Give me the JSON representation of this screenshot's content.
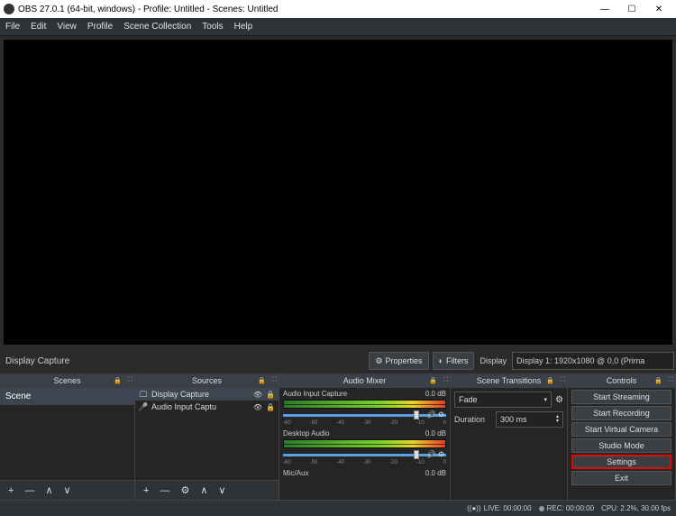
{
  "window": {
    "title": "OBS 27.0.1 (64-bit, windows) - Profile: Untitled - Scenes: Untitled",
    "minimize": "—",
    "maximize": "☐",
    "close": "✕"
  },
  "menubar": {
    "file": "File",
    "edit": "Edit",
    "view": "View",
    "profile": "Profile",
    "scene": "Scene Collection",
    "tools": "Tools",
    "help": "Help"
  },
  "context": {
    "source_name": "Display Capture",
    "properties": "Properties",
    "filters": "Filters",
    "display_label": "Display",
    "display_select": "Display 1: 1920x1080 @ 0,0 (Prima"
  },
  "scenes": {
    "header": "Scenes",
    "items": [
      "Scene"
    ]
  },
  "sources": {
    "header": "Sources",
    "items": [
      {
        "type": "display",
        "name": "Display Capture"
      },
      {
        "type": "audio",
        "name": "Audio Input Captu"
      }
    ]
  },
  "mixer": {
    "header": "Audio Mixer",
    "channels": [
      {
        "name": "Audio Input Capture",
        "db": "0.0 dB",
        "ticks": [
          "-60",
          "-50",
          "-40",
          "-30",
          "-20",
          "-10",
          "0"
        ]
      },
      {
        "name": "Desktop Audio",
        "db": "0.0 dB",
        "ticks": [
          "-60",
          "-50",
          "-40",
          "-30",
          "-20",
          "-10",
          "0"
        ]
      },
      {
        "name": "Mic/Aux",
        "db": "0.0 dB"
      }
    ]
  },
  "transitions": {
    "header": "Scene Transitions",
    "type": "Fade",
    "dur_label": "Duration",
    "duration": "300 ms"
  },
  "controls": {
    "header": "Controls",
    "buttons": [
      "Start Streaming",
      "Start Recording",
      "Start Virtual Camera",
      "Studio Mode",
      "Settings",
      "Exit"
    ],
    "highlighted": 4
  },
  "footer": {
    "add": "+",
    "remove": "—",
    "up": "∧",
    "down": "∨"
  },
  "status": {
    "live": "LIVE: 00:00:00",
    "rec": "REC: 00:00:00",
    "cpu": "CPU: 2.2%, 30.00 fps"
  }
}
